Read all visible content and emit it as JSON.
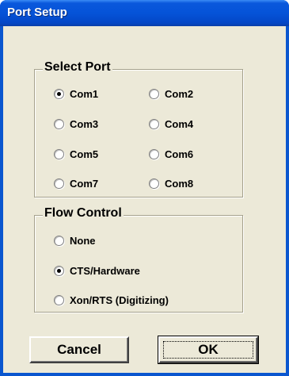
{
  "window": {
    "title": "Port Setup"
  },
  "select_port": {
    "legend": "Select Port",
    "options": [
      {
        "label": "Com1",
        "checked": true
      },
      {
        "label": "Com2",
        "checked": false
      },
      {
        "label": "Com3",
        "checked": false
      },
      {
        "label": "Com4",
        "checked": false
      },
      {
        "label": "Com5",
        "checked": false
      },
      {
        "label": "Com6",
        "checked": false
      },
      {
        "label": "Com7",
        "checked": false
      },
      {
        "label": "Com8",
        "checked": false
      }
    ]
  },
  "flow_control": {
    "legend": "Flow Control",
    "options": [
      {
        "label": "None",
        "checked": false
      },
      {
        "label": "CTS/Hardware",
        "checked": true
      },
      {
        "label": "Xon/RTS (Digitizing)",
        "checked": false
      }
    ]
  },
  "buttons": {
    "cancel": "Cancel",
    "ok": "OK"
  }
}
